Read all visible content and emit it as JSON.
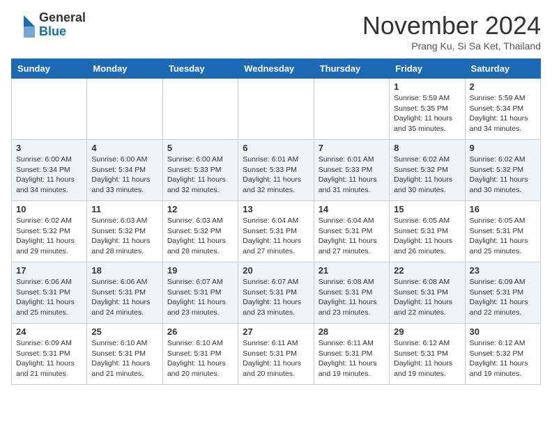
{
  "logo": {
    "general": "General",
    "blue": "Blue"
  },
  "header": {
    "month": "November 2024",
    "location": "Prang Ku, Si Sa Ket, Thailand"
  },
  "weekdays": [
    "Sunday",
    "Monday",
    "Tuesday",
    "Wednesday",
    "Thursday",
    "Friday",
    "Saturday"
  ],
  "weeks": [
    [
      {
        "day": "",
        "info": ""
      },
      {
        "day": "",
        "info": ""
      },
      {
        "day": "",
        "info": ""
      },
      {
        "day": "",
        "info": ""
      },
      {
        "day": "",
        "info": ""
      },
      {
        "day": "1",
        "info": "Sunrise: 5:59 AM\nSunset: 5:35 PM\nDaylight: 11 hours\nand 35 minutes."
      },
      {
        "day": "2",
        "info": "Sunrise: 5:59 AM\nSunset: 5:34 PM\nDaylight: 11 hours\nand 34 minutes."
      }
    ],
    [
      {
        "day": "3",
        "info": "Sunrise: 6:00 AM\nSunset: 5:34 PM\nDaylight: 11 hours\nand 34 minutes."
      },
      {
        "day": "4",
        "info": "Sunrise: 6:00 AM\nSunset: 5:34 PM\nDaylight: 11 hours\nand 33 minutes."
      },
      {
        "day": "5",
        "info": "Sunrise: 6:00 AM\nSunset: 5:33 PM\nDaylight: 11 hours\nand 32 minutes."
      },
      {
        "day": "6",
        "info": "Sunrise: 6:01 AM\nSunset: 5:33 PM\nDaylight: 11 hours\nand 32 minutes."
      },
      {
        "day": "7",
        "info": "Sunrise: 6:01 AM\nSunset: 5:33 PM\nDaylight: 11 hours\nand 31 minutes."
      },
      {
        "day": "8",
        "info": "Sunrise: 6:02 AM\nSunset: 5:32 PM\nDaylight: 11 hours\nand 30 minutes."
      },
      {
        "day": "9",
        "info": "Sunrise: 6:02 AM\nSunset: 5:32 PM\nDaylight: 11 hours\nand 30 minutes."
      }
    ],
    [
      {
        "day": "10",
        "info": "Sunrise: 6:02 AM\nSunset: 5:32 PM\nDaylight: 11 hours\nand 29 minutes."
      },
      {
        "day": "11",
        "info": "Sunrise: 6:03 AM\nSunset: 5:32 PM\nDaylight: 11 hours\nand 28 minutes."
      },
      {
        "day": "12",
        "info": "Sunrise: 6:03 AM\nSunset: 5:32 PM\nDaylight: 11 hours\nand 28 minutes."
      },
      {
        "day": "13",
        "info": "Sunrise: 6:04 AM\nSunset: 5:31 PM\nDaylight: 11 hours\nand 27 minutes."
      },
      {
        "day": "14",
        "info": "Sunrise: 6:04 AM\nSunset: 5:31 PM\nDaylight: 11 hours\nand 27 minutes."
      },
      {
        "day": "15",
        "info": "Sunrise: 6:05 AM\nSunset: 5:31 PM\nDaylight: 11 hours\nand 26 minutes."
      },
      {
        "day": "16",
        "info": "Sunrise: 6:05 AM\nSunset: 5:31 PM\nDaylight: 11 hours\nand 25 minutes."
      }
    ],
    [
      {
        "day": "17",
        "info": "Sunrise: 6:06 AM\nSunset: 5:31 PM\nDaylight: 11 hours\nand 25 minutes."
      },
      {
        "day": "18",
        "info": "Sunrise: 6:06 AM\nSunset: 5:31 PM\nDaylight: 11 hours\nand 24 minutes."
      },
      {
        "day": "19",
        "info": "Sunrise: 6:07 AM\nSunset: 5:31 PM\nDaylight: 11 hours\nand 23 minutes."
      },
      {
        "day": "20",
        "info": "Sunrise: 6:07 AM\nSunset: 5:31 PM\nDaylight: 11 hours\nand 23 minutes."
      },
      {
        "day": "21",
        "info": "Sunrise: 6:08 AM\nSunset: 5:31 PM\nDaylight: 11 hours\nand 23 minutes."
      },
      {
        "day": "22",
        "info": "Sunrise: 6:08 AM\nSunset: 5:31 PM\nDaylight: 11 hours\nand 22 minutes."
      },
      {
        "day": "23",
        "info": "Sunrise: 6:09 AM\nSunset: 5:31 PM\nDaylight: 11 hours\nand 22 minutes."
      }
    ],
    [
      {
        "day": "24",
        "info": "Sunrise: 6:09 AM\nSunset: 5:31 PM\nDaylight: 11 hours\nand 21 minutes."
      },
      {
        "day": "25",
        "info": "Sunrise: 6:10 AM\nSunset: 5:31 PM\nDaylight: 11 hours\nand 21 minutes."
      },
      {
        "day": "26",
        "info": "Sunrise: 6:10 AM\nSunset: 5:31 PM\nDaylight: 11 hours\nand 20 minutes."
      },
      {
        "day": "27",
        "info": "Sunrise: 6:11 AM\nSunset: 5:31 PM\nDaylight: 11 hours\nand 20 minutes."
      },
      {
        "day": "28",
        "info": "Sunrise: 6:11 AM\nSunset: 5:31 PM\nDaylight: 11 hours\nand 19 minutes."
      },
      {
        "day": "29",
        "info": "Sunrise: 6:12 AM\nSunset: 5:31 PM\nDaylight: 11 hours\nand 19 minutes."
      },
      {
        "day": "30",
        "info": "Sunrise: 6:12 AM\nSunset: 5:32 PM\nDaylight: 11 hours\nand 19 minutes."
      }
    ]
  ]
}
